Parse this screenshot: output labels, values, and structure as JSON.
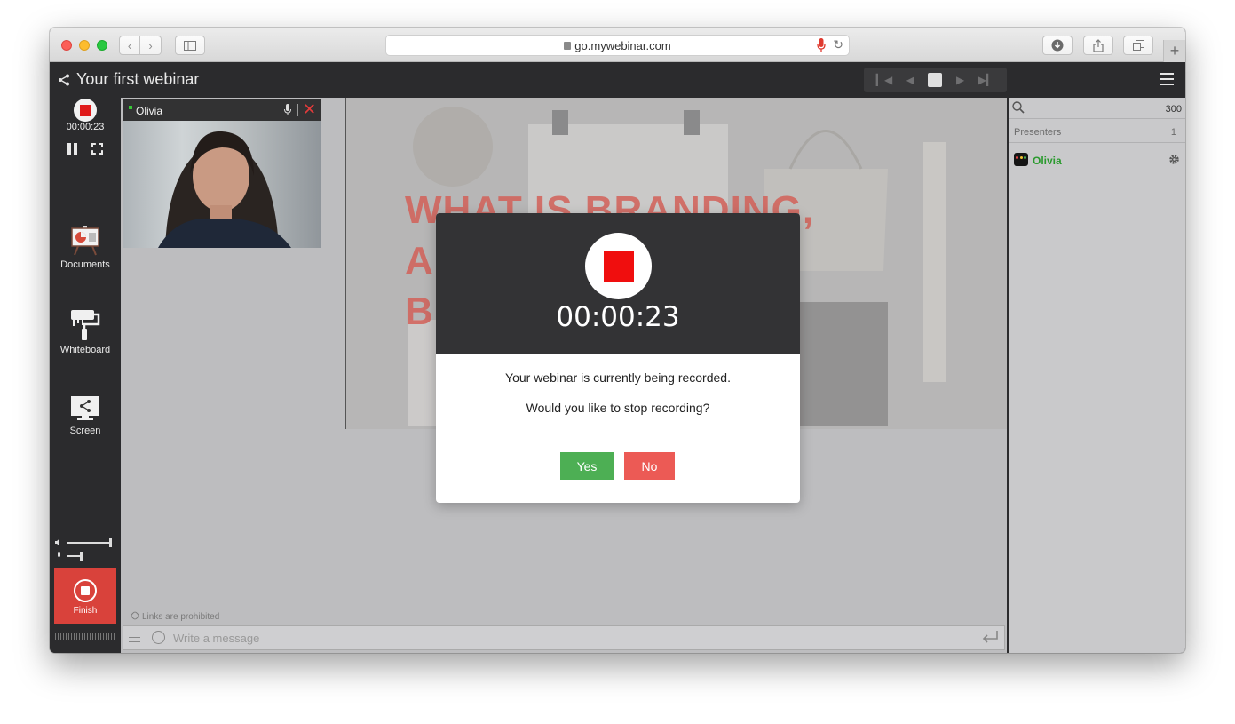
{
  "browser": {
    "url": "go.mywebinar.com",
    "icons": [
      "back-icon",
      "forward-icon",
      "sidebar-icon",
      "lock-icon",
      "mic-icon",
      "reload-icon",
      "download-icon",
      "share-icon",
      "tabs-icon",
      "new-tab-icon"
    ]
  },
  "header": {
    "title": "Your first webinar",
    "slide_controls": [
      "first-slide-icon",
      "prev-slide-icon",
      "stop-icon",
      "next-slide-icon",
      "last-slide-icon"
    ]
  },
  "sidebar": {
    "recording_time": "00:00:23",
    "tools": [
      {
        "label": "Documents",
        "icon": "presentation-easel-icon"
      },
      {
        "label": "Whiteboard",
        "icon": "paint-roller-icon"
      },
      {
        "label": "Screen",
        "icon": "screen-share-icon"
      }
    ],
    "finish_label": "Finish"
  },
  "webcam": {
    "name": "Olivia"
  },
  "slide": {
    "title": "WHAT IS BRANDING,\nA\nB                       TANT?"
  },
  "chat": {
    "links_note": "Links are prohibited",
    "placeholder": "Write a message"
  },
  "right_panel": {
    "participant_count": "300",
    "presenters_label": "Presenters",
    "presenters_count": "1",
    "presenter_name": "Olivia"
  },
  "modal": {
    "time": "00:00:23",
    "message": "Your webinar is currently being recorded.",
    "question": "Would you like to stop recording?",
    "yes_label": "Yes",
    "no_label": "No"
  },
  "colors": {
    "record_red": "#f00e0e",
    "yes_green": "#4daf54",
    "no_red": "#ec5a55",
    "finish_red": "#d9423b",
    "presenter_green": "#2a9a2e",
    "dark_bg": "#2b2b2d"
  }
}
